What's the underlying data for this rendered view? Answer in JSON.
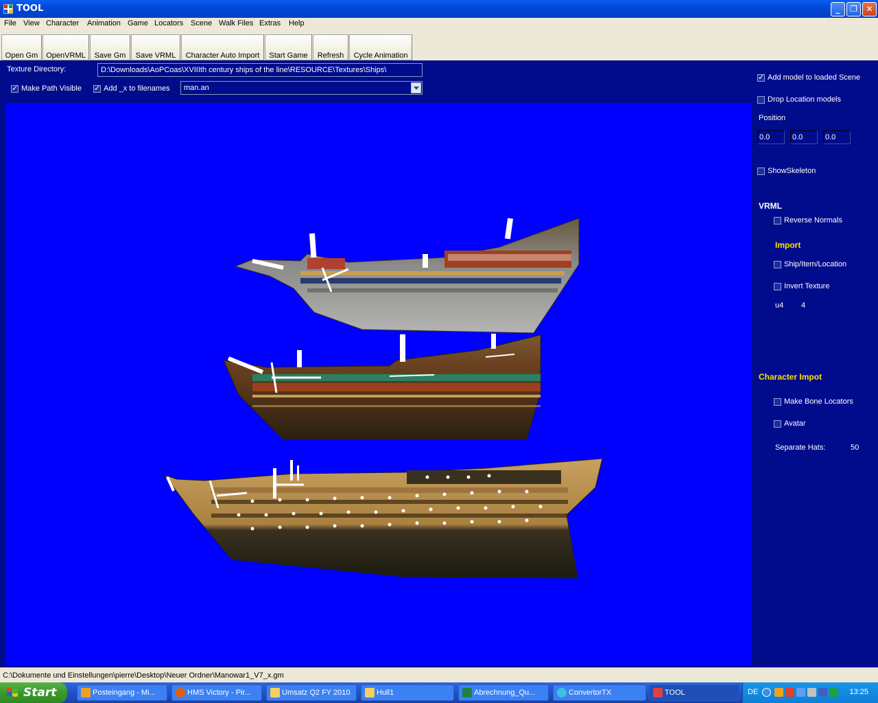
{
  "window": {
    "title": "TOOL"
  },
  "menu": [
    "File",
    "View",
    "Character",
    "Animation",
    "Game",
    "Locators",
    "Scene",
    "Walk Files",
    "Extras",
    "Help"
  ],
  "toolbar": [
    "Open Gm",
    "OpenVRML",
    "Save Gm",
    "Save VRML",
    "Character Auto Import",
    "Start Game",
    "Refresh",
    "Cycle Animation"
  ],
  "texture": {
    "label": "Texture Directory:",
    "path": "D:\\Downloads\\AoPCoas\\XVIIIth century ships of the line\\RESOURCE\\Textures\\Ships\\"
  },
  "options": {
    "make_path_visible": {
      "label": "Make Path Visible",
      "checked": true
    },
    "add_x": {
      "label": "Add _x to filenames",
      "checked": true
    },
    "animation_file": "man.an"
  },
  "right_panel": {
    "add_model": {
      "label": "Add model to loaded Scene",
      "checked": true
    },
    "drop_location": {
      "label": "Drop Location models",
      "checked": false
    },
    "position_label": "Position",
    "position": [
      "0.0",
      "0.0",
      "0.0"
    ],
    "show_skeleton": {
      "label": "ShowSkeleton",
      "checked": false
    },
    "vrml_heading": "VRML",
    "reverse_normals": {
      "label": "Reverse Normals",
      "checked": false
    },
    "import_heading": "Import",
    "ship_item_location": {
      "label": "Ship/Item/Location",
      "checked": false
    },
    "invert_texture": {
      "label": "Invert Texture",
      "checked": false
    },
    "u_label": "u4",
    "u_value": "4",
    "char_import_heading": "Character Impot",
    "make_bone_locators": {
      "label": "Make Bone Locators",
      "checked": false
    },
    "avatar": {
      "label": "Avatar",
      "checked": false
    },
    "separate_hats_label": "Separate Hats:",
    "separate_hats_value": "50"
  },
  "status": "C:\\Dokumente und Einstellungen\\pierre\\Desktop\\Neuer Ordner\\Manowar1_V7_x.gm",
  "taskbar": {
    "start": "Start",
    "tasks": [
      {
        "label": "Posteingang - Mi...",
        "color": "#f0a020"
      },
      {
        "label": "HMS Victory - Pir...",
        "color": "#e06010"
      },
      {
        "label": "Umsatz Q2 FY 2010",
        "color": "#f4d060"
      },
      {
        "label": "Hull1",
        "color": "#f4d060"
      },
      {
        "label": "Abrechnung_Qu...",
        "color": "#208040"
      },
      {
        "label": "ConvertorTX",
        "color": "#40c0e0"
      },
      {
        "label": "TOOL",
        "color": "#e04040"
      }
    ],
    "lang": "DE",
    "time": "13:25"
  },
  "colors": {
    "viewport": "#0000ff",
    "panel": "#000c8c",
    "heading_yellow": "#ffe000"
  }
}
